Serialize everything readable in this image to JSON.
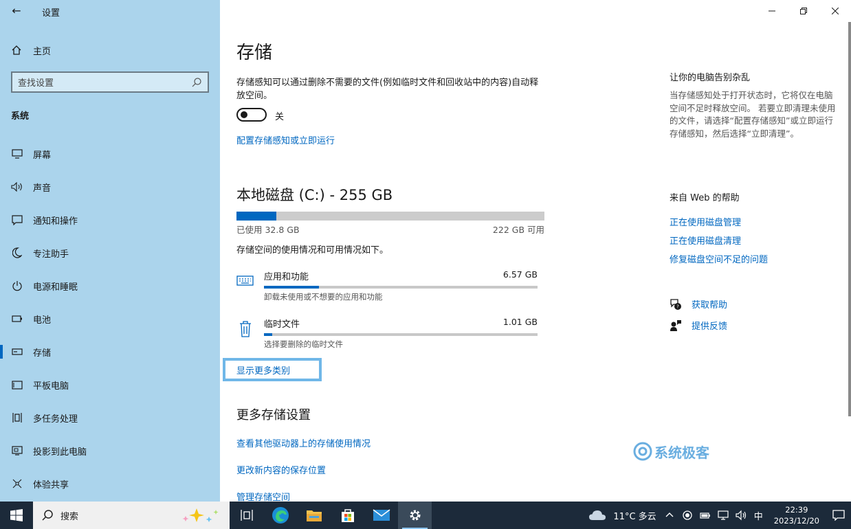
{
  "window": {
    "title": "设置"
  },
  "sidebar": {
    "home_label": "主页",
    "search_placeholder": "查找设置",
    "section": "系统",
    "items": [
      {
        "label": "屏幕",
        "icon": "monitor-icon"
      },
      {
        "label": "声音",
        "icon": "speaker-icon"
      },
      {
        "label": "通知和操作",
        "icon": "notification-icon"
      },
      {
        "label": "专注助手",
        "icon": "moon-icon"
      },
      {
        "label": "电源和睡眠",
        "icon": "power-icon"
      },
      {
        "label": "电池",
        "icon": "battery-icon"
      },
      {
        "label": "存储",
        "icon": "storage-icon",
        "active": true
      },
      {
        "label": "平板电脑",
        "icon": "tablet-icon"
      },
      {
        "label": "多任务处理",
        "icon": "multitask-icon"
      },
      {
        "label": "投影到此电脑",
        "icon": "project-icon"
      },
      {
        "label": "体验共享",
        "icon": "share-icon"
      }
    ]
  },
  "main": {
    "title": "存储",
    "sense_desc": "存储感知可以通过删除不需要的文件(例如临时文件和回收站中的内容)自动释放空间。",
    "toggle_state": "关",
    "configure_link": "配置存储感知或立即运行",
    "disk": {
      "title": "本地磁盘 (C:) - 255 GB",
      "used_label": "已使用 32.8 GB",
      "free_label": "222 GB 可用",
      "used_fraction": 0.129
    },
    "usage_desc": "存储空间的使用情况和可用情况如下。",
    "categories": [
      {
        "name": "应用和功能",
        "size": "6.57 GB",
        "desc": "卸载未使用或不想要的应用和功能",
        "fraction": 0.2,
        "icon": "keyboard-icon"
      },
      {
        "name": "临时文件",
        "size": "1.01 GB",
        "desc": "选择要删除的临时文件",
        "fraction": 0.03,
        "icon": "trash-icon"
      }
    ],
    "show_more": "显示更多类别",
    "more_title": "更多存储设置",
    "more_links": [
      "查看其他驱动器上的存储使用情况",
      "更改新内容的保存位置",
      "管理存储空间"
    ]
  },
  "right": {
    "title": "让你的电脑告别杂乱",
    "desc": "当存储感知处于打开状态时，它将仅在电脑空间不足时释放空间。 若要立即清理未使用的文件，请选择“配置存储感知”或立即运行存储感知，然后选择“立即清理”。",
    "web_title": "来自 Web 的帮助",
    "web_links": [
      "正在使用磁盘管理",
      "正在使用磁盘清理",
      "修复磁盘空间不足的问题"
    ],
    "get_help": "获取帮助",
    "feedback": "提供反馈"
  },
  "watermark": "系统极客",
  "taskbar": {
    "search_placeholder": "搜索",
    "weather": "11°C 多云",
    "ime": "中",
    "time": "22:39",
    "date": "2023/12/20"
  },
  "colors": {
    "accent": "#0067c0",
    "sidebar_bg": "#abd4ec",
    "taskbar_bg": "#1c2a3a"
  }
}
